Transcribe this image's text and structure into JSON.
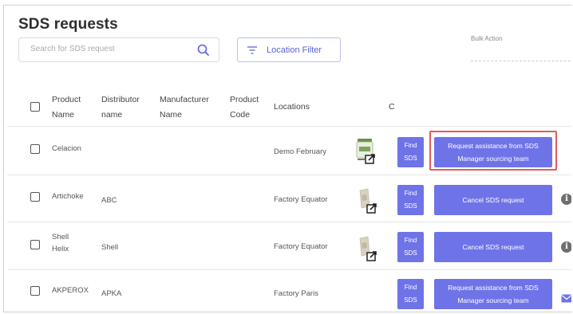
{
  "page": {
    "title": "SDS requests"
  },
  "toolbar": {
    "search_placeholder": "Search for SDS request",
    "location_filter_label": "Location Filter",
    "bulk_action_label": "Bulk Action"
  },
  "table": {
    "headers": {
      "product_name": [
        "Product",
        "Name"
      ],
      "distributor_name": [
        "Distributor",
        "name"
      ],
      "manufacturer_name": [
        "Manufacturer",
        "Name"
      ],
      "product_code": [
        "Product",
        "Code"
      ],
      "locations": "Locations",
      "c": "C"
    },
    "rows": [
      {
        "product": [
          "Celacion"
        ],
        "distributor": "",
        "location": "Demo February",
        "find_label": [
          "Find",
          "SDS"
        ],
        "action_label": "Request assistance from SDS Manager sourcing team",
        "trailing_icon": "none"
      },
      {
        "product": [
          "Artichoke"
        ],
        "distributor": "ABC",
        "location": "Factory Equator",
        "find_label": [
          "Find",
          "SDS"
        ],
        "action_label": "Cancel SDS request",
        "trailing_icon": "info-icon"
      },
      {
        "product": [
          "Shell",
          "Helix"
        ],
        "distributor": "Shell",
        "location": "Factory Equator",
        "find_label": [
          "Find",
          "SDS"
        ],
        "action_label": "Cancel SDS request",
        "trailing_icon": "info-icon"
      },
      {
        "product": [
          "AKPEROX"
        ],
        "distributor": "APKA",
        "location": "Factory Paris",
        "find_label": [
          "Find",
          "SDS"
        ],
        "action_label": "Request assistance from SDS Manager sourcing team",
        "trailing_icon": "mail-icon"
      }
    ]
  },
  "colors": {
    "accent": "#6f73e8",
    "highlight": "#e35a5a",
    "filter_text": "#5a63d8"
  },
  "icons": {
    "search": "search-icon",
    "filter": "filter-icon",
    "open_external": "external-link-icon",
    "info": "info-icon",
    "mail": "mail-icon"
  }
}
